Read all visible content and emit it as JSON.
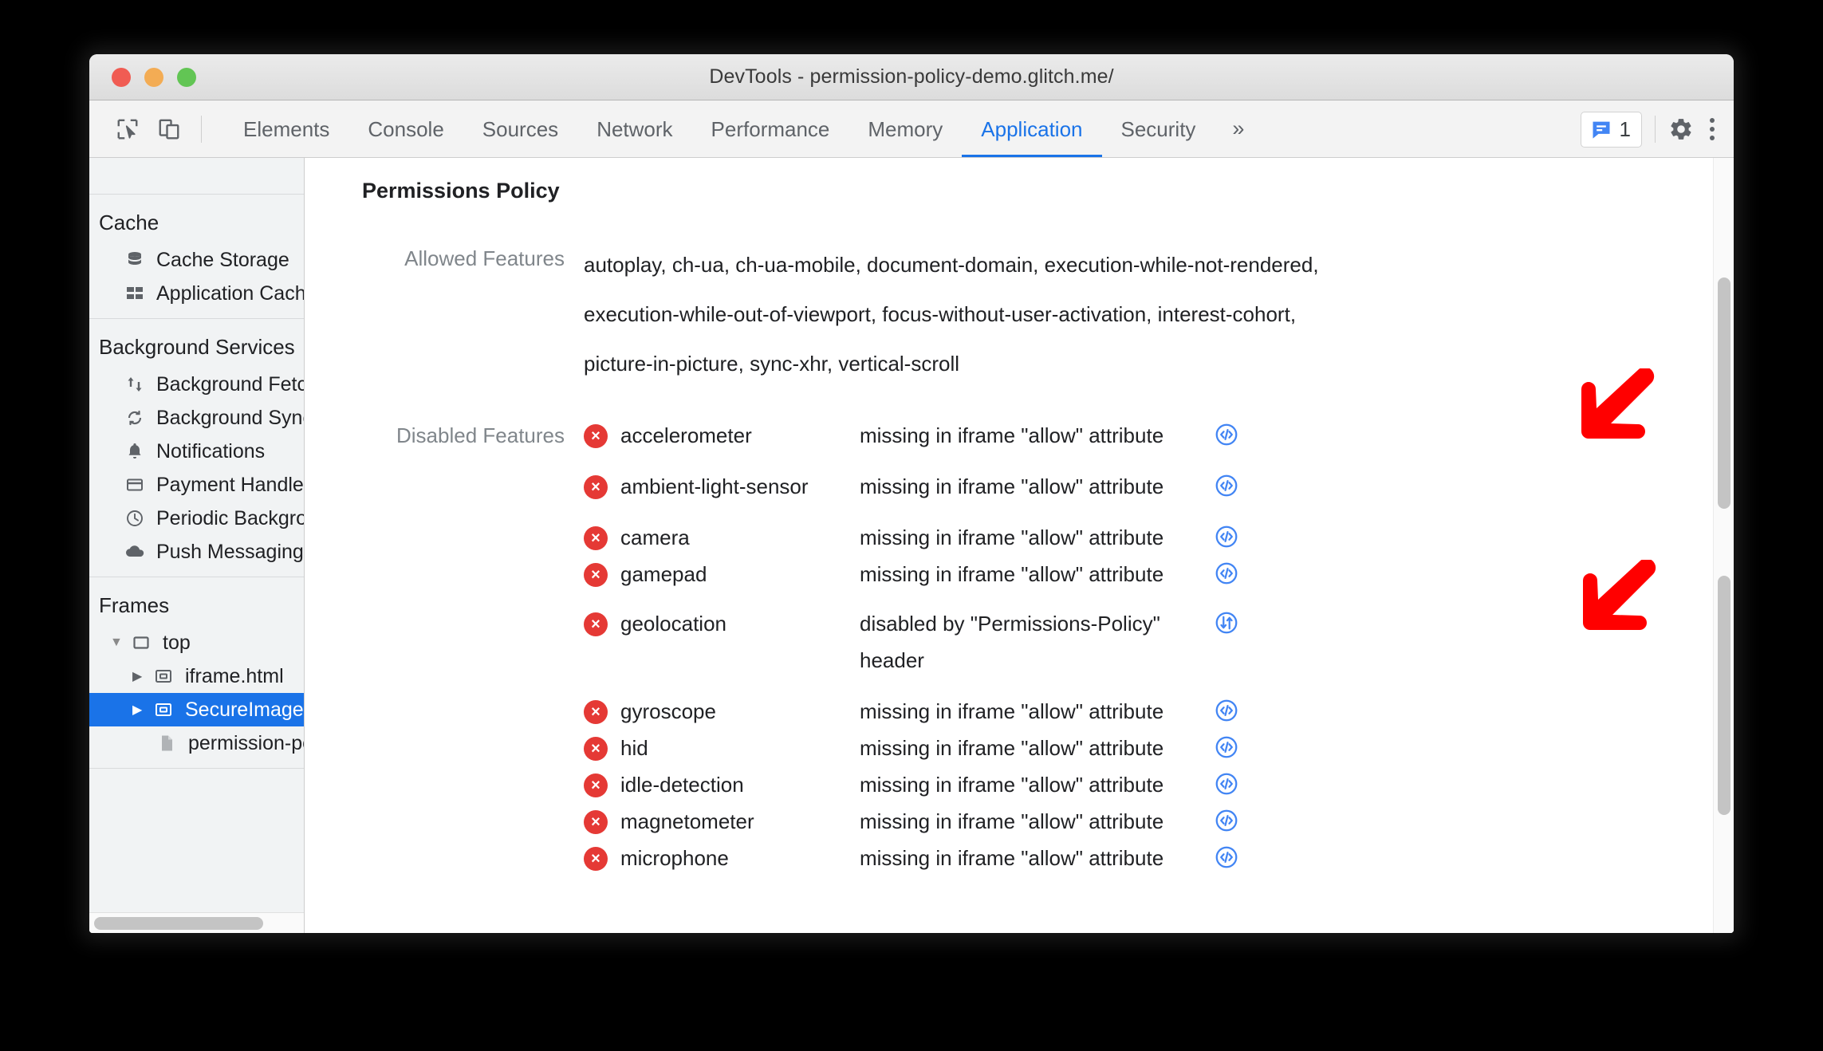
{
  "window": {
    "title": "DevTools - permission-policy-demo.glitch.me/",
    "traffic_lights": [
      "close",
      "minimize",
      "maximize"
    ]
  },
  "toolbar": {
    "icons": [
      "inspect-element-icon",
      "device-toolbar-icon"
    ],
    "tabs": [
      {
        "label": "Elements",
        "active": false
      },
      {
        "label": "Console",
        "active": false
      },
      {
        "label": "Sources",
        "active": false
      },
      {
        "label": "Network",
        "active": false
      },
      {
        "label": "Performance",
        "active": false
      },
      {
        "label": "Memory",
        "active": false
      },
      {
        "label": "Application",
        "active": true
      },
      {
        "label": "Security",
        "active": false
      }
    ],
    "more_tabs_label": "»",
    "message_count": "1",
    "settings_label": "Settings",
    "more_options_label": "Customize and control DevTools",
    "accent_color": "#1a73e8"
  },
  "sidebar": {
    "sections": [
      {
        "title": "Cache",
        "items": [
          {
            "label": "Cache Storage",
            "icon": "database-icon",
            "selected": false
          },
          {
            "label": "Application Cache",
            "icon": "grid-icon",
            "selected": false
          }
        ]
      },
      {
        "title": "Background Services",
        "items": [
          {
            "label": "Background Fetch",
            "icon": "up-down-arrows-icon",
            "selected": false
          },
          {
            "label": "Background Sync",
            "icon": "sync-icon",
            "selected": false
          },
          {
            "label": "Notifications",
            "icon": "bell-icon",
            "selected": false
          },
          {
            "label": "Payment Handler",
            "icon": "credit-card-icon",
            "selected": false
          },
          {
            "label": "Periodic Backgroun",
            "icon": "clock-icon",
            "selected": false
          },
          {
            "label": "Push Messaging",
            "icon": "cloud-icon",
            "selected": false
          }
        ]
      },
      {
        "title": "Frames",
        "items": [
          {
            "label": "top",
            "icon": "frame-icon",
            "twisty": "down",
            "depth": 1,
            "selected": false
          },
          {
            "label": "iframe.html",
            "icon": "iframe-icon",
            "twisty": "right",
            "depth": 2,
            "selected": false
          },
          {
            "label": "SecureImage",
            "icon": "iframe-icon",
            "twisty": "right",
            "depth": 2,
            "selected": true
          },
          {
            "label": "permission-policy",
            "icon": "document-icon",
            "twisty": "none",
            "depth": 3,
            "selected": false
          }
        ]
      }
    ],
    "selection_color": "#1a73e8",
    "horizontal_scrollbar": true
  },
  "main": {
    "title": "Permissions Policy",
    "allowed": {
      "label": "Allowed Features",
      "lines": [
        "autoplay, ch-ua, ch-ua-mobile, document-domain, execution-while-not-rendered,",
        "execution-while-out-of-viewport, focus-without-user-activation, interest-cohort,",
        "picture-in-picture, sync-xhr, vertical-scroll"
      ]
    },
    "disabled": {
      "label": "Disabled Features",
      "rows": [
        {
          "name": "accelerometer",
          "reason": "missing in iframe \"allow\" attribute",
          "status_icon": "error-icon",
          "action_icon": "code-icon"
        },
        {
          "name": "ambient-light-sensor",
          "reason": "missing in iframe \"allow\" attribute",
          "status_icon": "error-icon",
          "action_icon": "code-icon"
        },
        {
          "name": "camera",
          "reason": "missing in iframe \"allow\" attribute",
          "status_icon": "error-icon",
          "action_icon": "code-icon"
        },
        {
          "name": "gamepad",
          "reason": "missing in iframe \"allow\" attribute",
          "status_icon": "error-icon",
          "action_icon": "code-icon"
        },
        {
          "name": "geolocation",
          "reason": "disabled by \"Permissions-Policy\" header",
          "status_icon": "error-icon",
          "action_icon": "network-request-icon"
        },
        {
          "name": "gyroscope",
          "reason": "missing in iframe \"allow\" attribute",
          "status_icon": "error-icon",
          "action_icon": "code-icon"
        },
        {
          "name": "hid",
          "reason": "missing in iframe \"allow\" attribute",
          "status_icon": "error-icon",
          "action_icon": "code-icon"
        },
        {
          "name": "idle-detection",
          "reason": "missing in iframe \"allow\" attribute",
          "status_icon": "error-icon",
          "action_icon": "code-icon"
        },
        {
          "name": "magnetometer",
          "reason": "missing in iframe \"allow\" attribute",
          "status_icon": "error-icon",
          "action_icon": "code-icon"
        },
        {
          "name": "microphone",
          "reason": "missing in iframe \"allow\" attribute",
          "status_icon": "error-icon",
          "action_icon": "code-icon"
        }
      ]
    },
    "error_color": "#e53935",
    "link_color": "#4285f4"
  },
  "annotations": {
    "arrow_color": "#ff0000",
    "arrows": [
      {
        "name": "arrow-pointing-code-icon-accelerometer"
      },
      {
        "name": "arrow-pointing-network-icon-geolocation"
      }
    ]
  }
}
